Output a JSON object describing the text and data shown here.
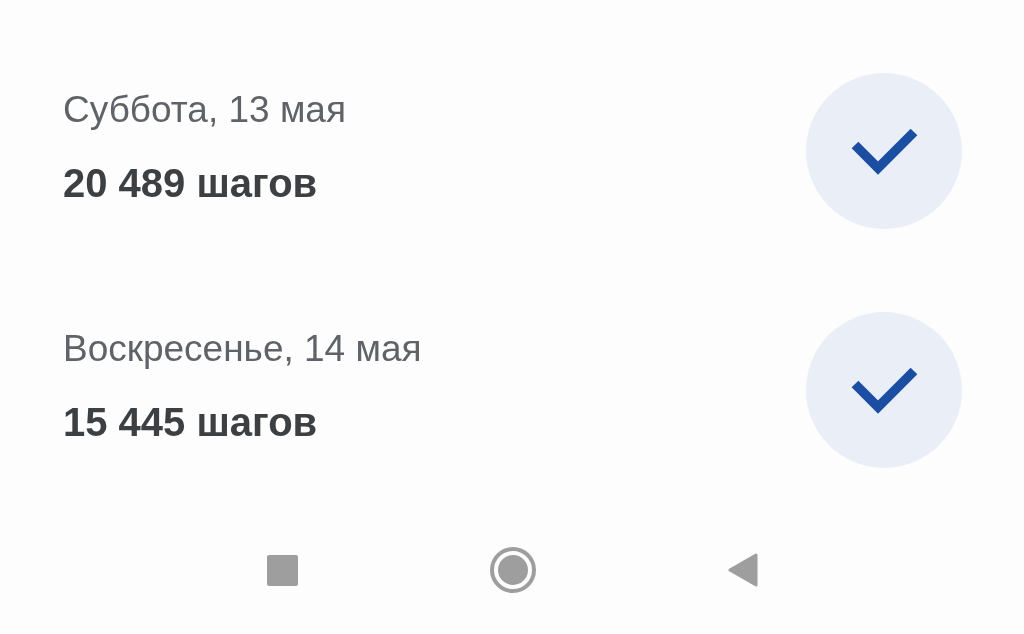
{
  "days": [
    {
      "date": "Суббота, 13 мая",
      "steps": "20 489 шагов",
      "done": true
    },
    {
      "date": "Воскресенье, 14 мая",
      "steps": "15 445 шагов",
      "done": true
    }
  ]
}
